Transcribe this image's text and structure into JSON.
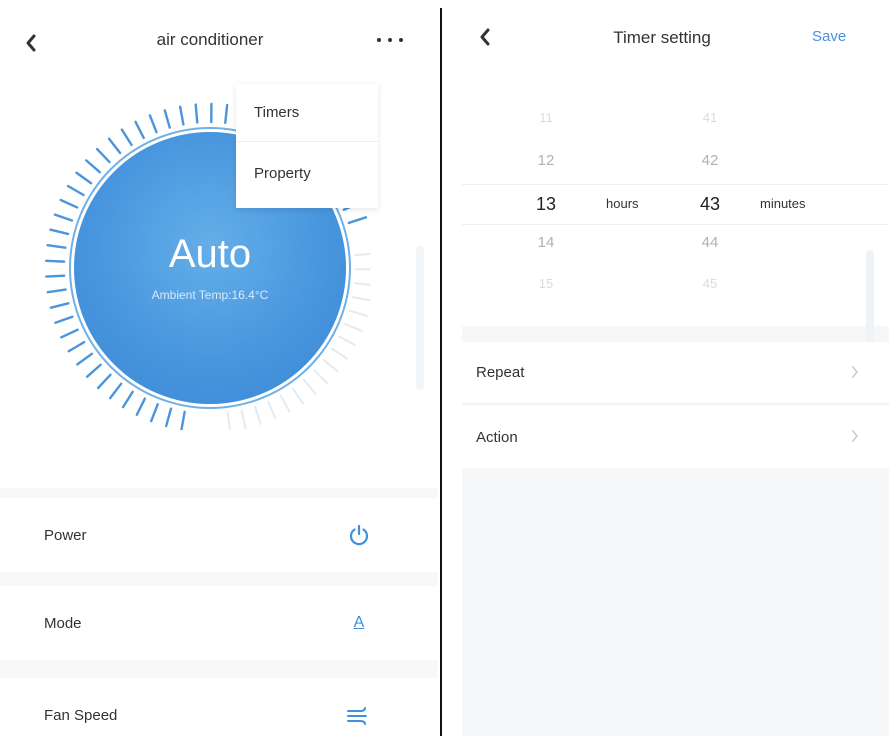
{
  "left_screen": {
    "header": {
      "title": "air conditioner",
      "back_icon": "chevron-left-icon",
      "more_icon": "more-dots-icon"
    },
    "dial": {
      "mode": "Auto",
      "ambient_temp": "Ambient Temp:16.4°C",
      "accent_color": "#4a95dd"
    },
    "menu": {
      "items": [
        "Timers",
        "Property"
      ]
    },
    "controls": [
      {
        "label": "Power",
        "icon": "power-icon"
      },
      {
        "label": "Mode",
        "icon": "mode-auto-icon",
        "icon_text": "A"
      },
      {
        "label": "Fan Speed",
        "icon": "fan-speed-icon"
      }
    ]
  },
  "right_screen": {
    "header": {
      "title": "Timer setting",
      "save_label": "Save",
      "back_icon": "chevron-left-icon",
      "save_color": "#4a8fe0"
    },
    "picker": {
      "hours": [
        "11",
        "12",
        "13",
        "14",
        "15"
      ],
      "minutes": [
        "41",
        "42",
        "43",
        "44",
        "45"
      ],
      "selected_hour": "13",
      "selected_minute": "43",
      "hours_unit": "hours",
      "minutes_unit": "minutes"
    },
    "rows": [
      {
        "label": "Repeat",
        "icon": "chevron-right-icon"
      },
      {
        "label": "Action",
        "icon": "chevron-right-icon"
      }
    ]
  }
}
